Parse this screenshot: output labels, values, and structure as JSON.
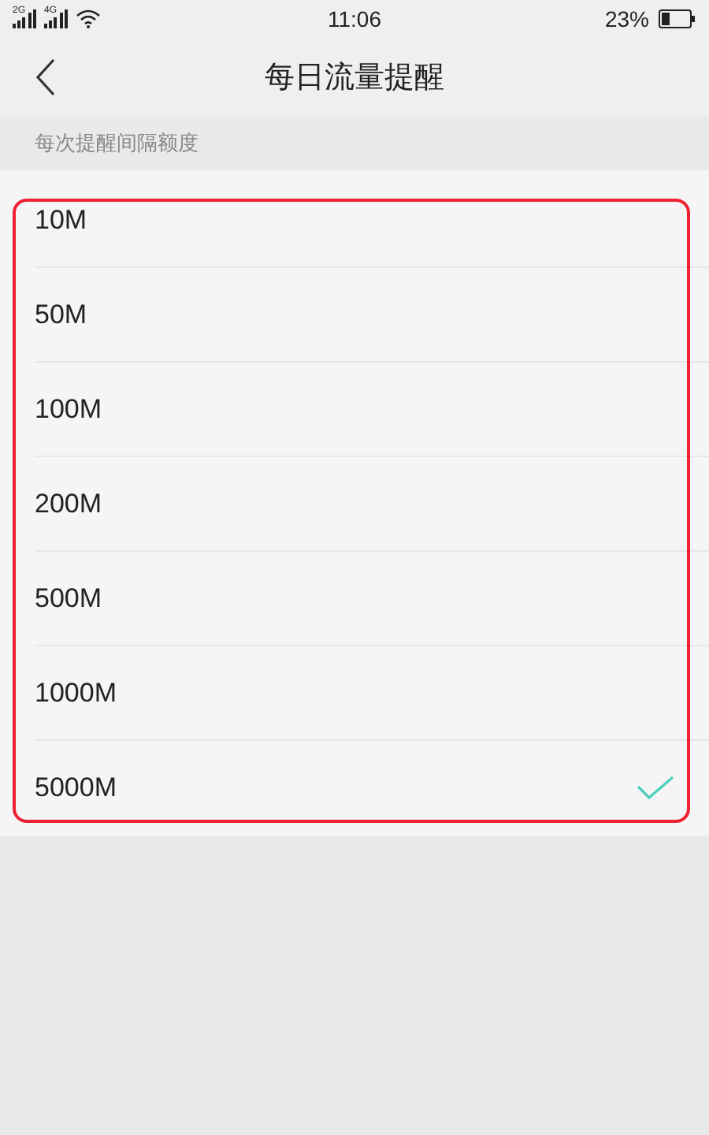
{
  "status_bar": {
    "time": "11:06",
    "battery_text": "23%",
    "network_labels": [
      "2G",
      "4G"
    ]
  },
  "header": {
    "title": "每日流量提醒"
  },
  "section": {
    "label": "每次提醒间隔额度"
  },
  "options": [
    {
      "label": "10M",
      "selected": false
    },
    {
      "label": "50M",
      "selected": false
    },
    {
      "label": "100M",
      "selected": false
    },
    {
      "label": "200M",
      "selected": false
    },
    {
      "label": "500M",
      "selected": false
    },
    {
      "label": "1000M",
      "selected": false
    },
    {
      "label": "5000M",
      "selected": true
    }
  ],
  "annotation": {
    "kind": "frame",
    "color": "#ee2233"
  }
}
